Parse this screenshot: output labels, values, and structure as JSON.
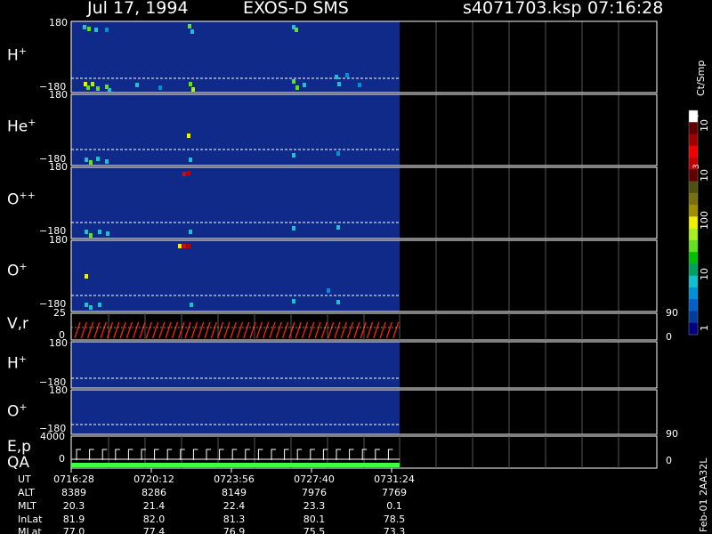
{
  "header": {
    "date": "Jul 17, 1994",
    "instrument": "EXOS-D SMS",
    "file": "s4071703.ksp",
    "time": "07:16:28"
  },
  "colorbar": {
    "unit": "Ct/Smp",
    "tick_labels": [
      "1",
      "10",
      "100",
      "10",
      "3",
      "10",
      "4"
    ],
    "colors": [
      "#000080",
      "#003c9c",
      "#0060c8",
      "#0090d8",
      "#10c0d0",
      "#00a060",
      "#00c000",
      "#60e020",
      "#a8f020",
      "#f0f000",
      "#a09000",
      "#787010",
      "#505010",
      "#600000",
      "#c00000",
      "#f00000",
      "#a00000",
      "#600000",
      "#ffffff"
    ]
  },
  "panels": [
    {
      "label_base": "H",
      "label_sup": "+",
      "y_top": "180",
      "y_bottom": "−180"
    },
    {
      "label_base": "He",
      "label_sup": "+",
      "y_top": "180",
      "y_bottom": "−180"
    },
    {
      "label_base": "O",
      "label_sup": "++",
      "y_top": "180",
      "y_bottom": "−180"
    },
    {
      "label_base": "O",
      "label_sup": "+",
      "y_top": "180",
      "y_bottom": "−180"
    }
  ],
  "vr_panel": {
    "label": "V,r",
    "y_top": "25",
    "y_bottom": "0",
    "right_top": "90",
    "right_bottom": "0"
  },
  "lower_panels": [
    {
      "label_base": "H",
      "label_sup": "+",
      "y_top": "180",
      "y_bottom": "−180"
    },
    {
      "label_base": "O",
      "label_sup": "+",
      "y_top": "180",
      "y_bottom": "−180"
    }
  ],
  "ep_panel": {
    "label_top": "E,p",
    "label_bottom": "QA",
    "y_top": "4000",
    "y_bottom": "0",
    "right_top": "90",
    "right_bottom": "0"
  },
  "ut_table": {
    "rows": [
      {
        "label": "UT",
        "values": [
          "0716:28",
          "0720:12",
          "0723:56",
          "0727:40",
          "0731:24"
        ]
      },
      {
        "label": "ALT",
        "values": [
          "8389",
          "8286",
          "8149",
          "7976",
          "7769"
        ]
      },
      {
        "label": "MLT",
        "values": [
          "20.3",
          "21.4",
          "22.4",
          "23.3",
          "0.1"
        ]
      },
      {
        "label": "InLat",
        "values": [
          "81.9",
          "82.0",
          "81.3",
          "80.1",
          "78.5"
        ]
      },
      {
        "label": "MLat",
        "values": [
          "77.0",
          "77.4",
          "76.9",
          "75.5",
          "73.3"
        ]
      }
    ]
  },
  "footer_id": "Feb-01 2AA32L",
  "colors": {
    "panel_fill": "#102a8a",
    "frame": "#ffffff",
    "vr_trace": "#ff2000",
    "qa_bar": "#40ff40"
  },
  "chart_data": {
    "type": "heatmap",
    "title": "Jul 17, 1994   EXOS-D SMS",
    "x_start": "07:16:28",
    "x_tick_labels": [
      "0716:28",
      "0720:12",
      "0723:56",
      "0727:40",
      "0731:24"
    ],
    "y_range": [
      -180,
      180
    ],
    "colorbar_range": [
      1,
      10000
    ],
    "colorbar_scale": "log",
    "series": [
      {
        "name": "H+",
        "ylim": [
          -180,
          180
        ]
      },
      {
        "name": "He+",
        "ylim": [
          -180,
          180
        ]
      },
      {
        "name": "O++",
        "ylim": [
          -180,
          180
        ]
      },
      {
        "name": "O+",
        "ylim": [
          -180,
          180
        ]
      },
      {
        "name": "V,r",
        "ylim": [
          0,
          25
        ]
      },
      {
        "name": "H+",
        "ylim": [
          -180,
          180
        ]
      },
      {
        "name": "O+",
        "ylim": [
          -180,
          180
        ]
      },
      {
        "name": "E,p",
        "ylim": [
          0,
          4000
        ]
      }
    ]
  }
}
